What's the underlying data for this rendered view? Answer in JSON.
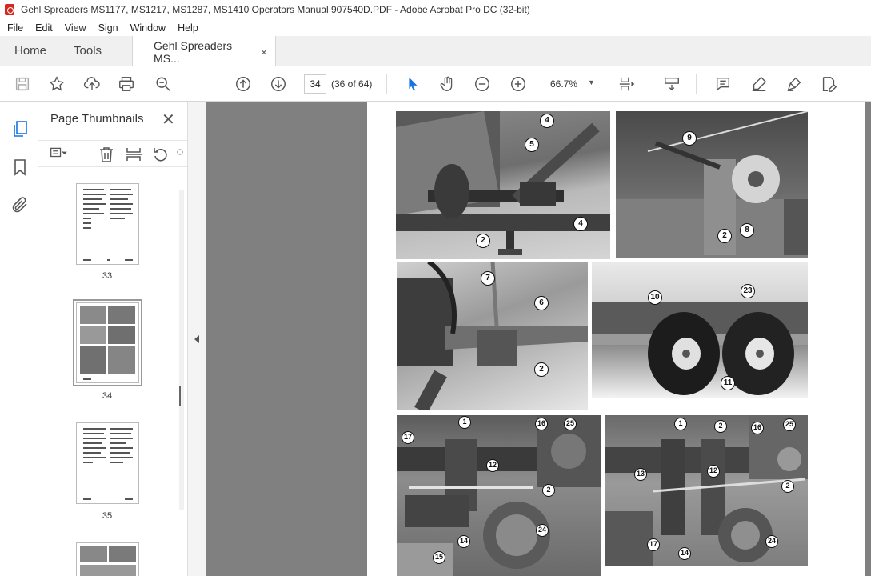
{
  "window": {
    "title": "Gehl Spreaders MS1177, MS1217, MS1287, MS1410 Operators Manual 907540D.PDF - Adobe Acrobat Pro DC (32-bit)"
  },
  "menu": [
    "File",
    "Edit",
    "View",
    "Sign",
    "Window",
    "Help"
  ],
  "tabs": {
    "home": "Home",
    "tools": "Tools",
    "document": "Gehl Spreaders MS...",
    "close": "×"
  },
  "toolbar": {
    "page_number": "34",
    "page_count": "(36 of 64)",
    "zoom": "66.7%",
    "icons": [
      "save-icon",
      "bookmark-star-icon",
      "upload-icon",
      "print-icon",
      "zoom-search-icon",
      "prev-page-icon",
      "next-page-icon",
      "select-arrow-icon",
      "hand-icon",
      "zoom-out-icon",
      "zoom-in-icon",
      "page-layout-icon",
      "scroll-icon",
      "comment-icon",
      "highlight-icon",
      "sign-icon",
      "edit-pdf-icon"
    ]
  },
  "thumbnails": {
    "title": "Page Thumbnails",
    "close": "✕",
    "pages": [
      {
        "label": "33"
      },
      {
        "label": "34",
        "selected": true
      },
      {
        "label": "35"
      }
    ]
  },
  "page": {
    "callouts": {
      "photo1": [
        "4",
        "5",
        "2",
        "4"
      ],
      "photo2": [
        "9",
        "2",
        "8"
      ],
      "photo3": [
        "7",
        "6",
        "2"
      ],
      "photo4": [
        "10",
        "23",
        "11"
      ],
      "photo5": [
        "17",
        "1",
        "16",
        "25",
        "12",
        "2",
        "24",
        "14",
        "15"
      ],
      "photo6": [
        "1",
        "2",
        "16",
        "25",
        "13",
        "12",
        "2",
        "17",
        "14",
        "24"
      ]
    }
  }
}
